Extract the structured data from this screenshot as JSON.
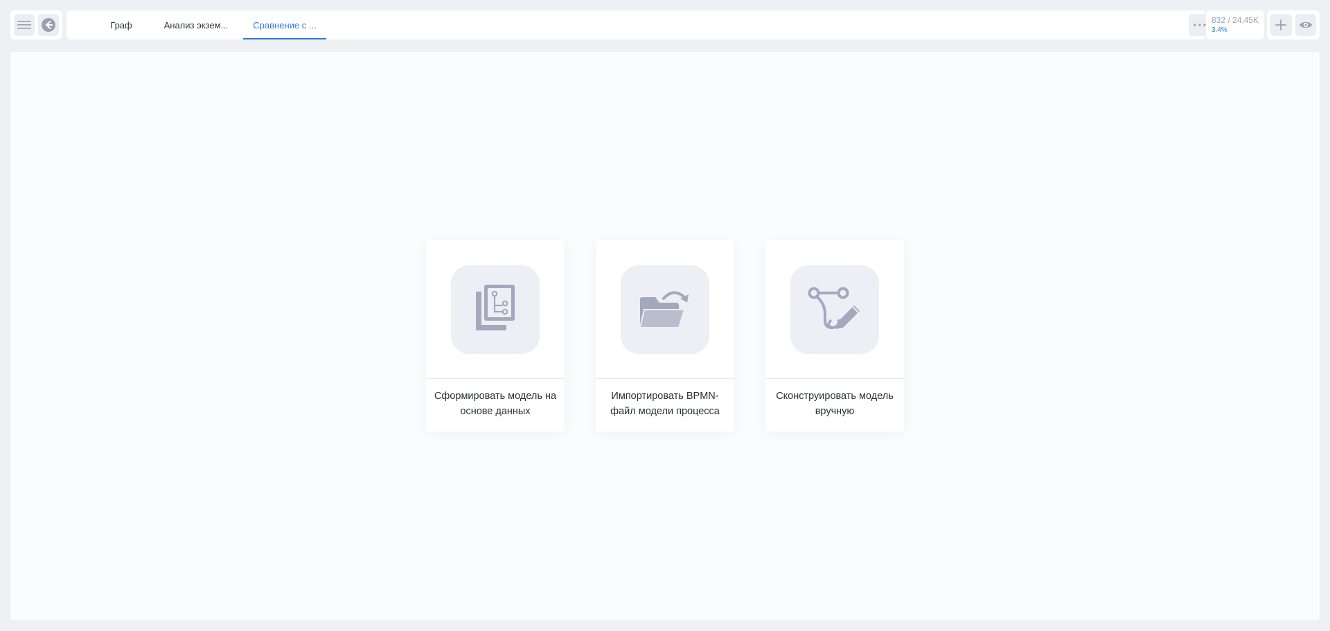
{
  "tabs": [
    {
      "label": "Граф"
    },
    {
      "label": "Анализ экзем..."
    },
    {
      "label": "Сравнение с ..."
    }
  ],
  "counter": {
    "value": "832 / 24,45K",
    "percent": "3.4%"
  },
  "cards": [
    {
      "label": "Сформировать модель на основе данных",
      "icon": "data-model-icon"
    },
    {
      "label": "Импортировать BPMN-файл модели процесса",
      "icon": "folder-import-icon"
    },
    {
      "label": "Сконструировать модель вручную",
      "icon": "manual-construct-icon"
    }
  ],
  "colors": {
    "accent": "#2e7bd8",
    "icon": "#a3a8bd",
    "icon_bg": "#eeeff4",
    "page_bg": "#eef0f4"
  }
}
